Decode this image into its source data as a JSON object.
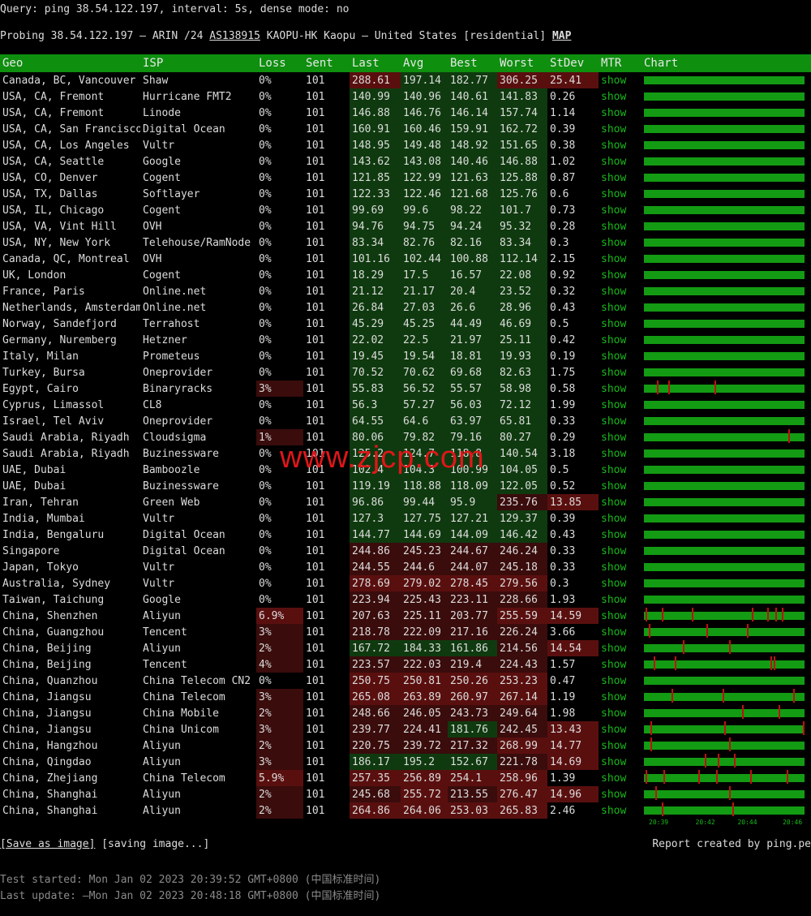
{
  "query": "Query: ping 38.54.122.197, interval: 5s, dense mode: no",
  "probe": {
    "prefix": "Probing 38.54.122.197 – ARIN /24 ",
    "as_link": "AS138915",
    "middle": " KAOPU-HK Kaopu – United States [residential] ",
    "map_link": "MAP"
  },
  "columns": [
    "Geo",
    "ISP",
    "Loss",
    "Sent",
    "Last",
    "Avg",
    "Best",
    "Worst",
    "StDev",
    "MTR",
    "Chart"
  ],
  "mtr_label": "show",
  "colors": {
    "green": "#0f3a0f",
    "red": "#3a0c0c",
    "redDark": "#5a0f0f",
    "header": "#0e8f0e",
    "bar": "#139b13",
    "spike": "#c01010"
  },
  "rows": [
    {
      "geo": "Canada, BC, Vancouver",
      "isp": "Shaw",
      "loss": "0%",
      "sent": "101",
      "last": "288.61",
      "avg": "197.14",
      "best": "182.77",
      "worst": "306.25",
      "stdev": "25.41",
      "spikes": []
    },
    {
      "geo": "USA, CA, Fremont",
      "isp": "Hurricane FMT2",
      "loss": "0%",
      "sent": "101",
      "last": "140.99",
      "avg": "140.96",
      "best": "140.61",
      "worst": "141.83",
      "stdev": "0.26",
      "spikes": []
    },
    {
      "geo": "USA, CA, Fremont",
      "isp": "Linode",
      "loss": "0%",
      "sent": "101",
      "last": "146.88",
      "avg": "146.76",
      "best": "146.14",
      "worst": "157.74",
      "stdev": "1.14",
      "spikes": []
    },
    {
      "geo": "USA, CA, San Francisco",
      "isp": "Digital Ocean",
      "loss": "0%",
      "sent": "101",
      "last": "160.91",
      "avg": "160.46",
      "best": "159.91",
      "worst": "162.72",
      "stdev": "0.39",
      "spikes": []
    },
    {
      "geo": "USA, CA, Los Angeles",
      "isp": "Vultr",
      "loss": "0%",
      "sent": "101",
      "last": "148.95",
      "avg": "149.48",
      "best": "148.92",
      "worst": "151.65",
      "stdev": "0.38",
      "spikes": []
    },
    {
      "geo": "USA, CA, Seattle",
      "isp": "Google",
      "loss": "0%",
      "sent": "101",
      "last": "143.62",
      "avg": "143.08",
      "best": "140.46",
      "worst": "146.88",
      "stdev": "1.02",
      "spikes": []
    },
    {
      "geo": "USA, CO, Denver",
      "isp": "Cogent",
      "loss": "0%",
      "sent": "101",
      "last": "121.85",
      "avg": "122.99",
      "best": "121.63",
      "worst": "125.88",
      "stdev": "0.87",
      "spikes": []
    },
    {
      "geo": "USA, TX, Dallas",
      "isp": "Softlayer",
      "loss": "0%",
      "sent": "101",
      "last": "122.33",
      "avg": "122.46",
      "best": "121.68",
      "worst": "125.76",
      "stdev": "0.6",
      "spikes": []
    },
    {
      "geo": "USA, IL, Chicago",
      "isp": "Cogent",
      "loss": "0%",
      "sent": "101",
      "last": "99.69",
      "avg": "99.6",
      "best": "98.22",
      "worst": "101.7",
      "stdev": "0.73",
      "spikes": []
    },
    {
      "geo": "USA, VA, Vint Hill",
      "isp": "OVH",
      "loss": "0%",
      "sent": "101",
      "last": "94.76",
      "avg": "94.75",
      "best": "94.24",
      "worst": "95.32",
      "stdev": "0.28",
      "spikes": []
    },
    {
      "geo": "USA, NY, New York",
      "isp": "Teleho​use/RamNode",
      "loss": "0%",
      "sent": "101",
      "last": "83.34",
      "avg": "82.76",
      "best": "82.16",
      "worst": "83.34",
      "stdev": "0.3",
      "spikes": []
    },
    {
      "geo": "Canada, QC, Montreal",
      "isp": "OVH",
      "loss": "0%",
      "sent": "101",
      "last": "101.16",
      "avg": "102.44",
      "best": "100.88",
      "worst": "112.14",
      "stdev": "2.15",
      "spikes": []
    },
    {
      "geo": "UK, London",
      "isp": "Cogent",
      "loss": "0%",
      "sent": "101",
      "last": "18.29",
      "avg": "17.5",
      "best": "16.57",
      "worst": "22.08",
      "stdev": "0.92",
      "spikes": []
    },
    {
      "geo": "France, Paris",
      "isp": "Online.net",
      "loss": "0%",
      "sent": "101",
      "last": "21.12",
      "avg": "21.17",
      "best": "20.4",
      "worst": "23.52",
      "stdev": "0.32",
      "spikes": []
    },
    {
      "geo": "Netherlands, Amsterdam",
      "isp": "Online.net",
      "loss": "0%",
      "sent": "101",
      "last": "26.84",
      "avg": "27.03",
      "best": "26.6",
      "worst": "28.96",
      "stdev": "0.43",
      "spikes": []
    },
    {
      "geo": "Norway, Sandefjord",
      "isp": "Terrahost",
      "loss": "0%",
      "sent": "101",
      "last": "45.29",
      "avg": "45.25",
      "best": "44.49",
      "worst": "46.69",
      "stdev": "0.5",
      "spikes": []
    },
    {
      "geo": "Germany, Nuremberg",
      "isp": "Hetzner",
      "loss": "0%",
      "sent": "101",
      "last": "22.02",
      "avg": "22.5",
      "best": "21.97",
      "worst": "25.11",
      "stdev": "0.42",
      "spikes": []
    },
    {
      "geo": "Italy, Milan",
      "isp": "Prometeus",
      "loss": "0%",
      "sent": "101",
      "last": "19.45",
      "avg": "19.54",
      "best": "18.81",
      "worst": "19.93",
      "stdev": "0.19",
      "spikes": []
    },
    {
      "geo": "Turkey, Bursa",
      "isp": "Oneprovider",
      "loss": "0%",
      "sent": "101",
      "last": "70.52",
      "avg": "70.62",
      "best": "69.68",
      "worst": "82.63",
      "stdev": "1.75",
      "spikes": []
    },
    {
      "geo": "Egypt, Cairo",
      "isp": "Binaryracks",
      "loss": "3%",
      "sent": "101",
      "last": "55.83",
      "avg": "56.52",
      "best": "55.57",
      "worst": "58.98",
      "stdev": "0.58",
      "spikes": [
        0.08,
        0.15,
        0.44
      ]
    },
    {
      "geo": "Cyprus, Limassol",
      "isp": "CL8",
      "loss": "0%",
      "sent": "101",
      "last": "56.3",
      "avg": "57.27",
      "best": "56.03",
      "worst": "72.12",
      "stdev": "1.99",
      "spikes": []
    },
    {
      "geo": "Israel, Tel Aviv",
      "isp": "Oneprovider",
      "loss": "0%",
      "sent": "101",
      "last": "64.55",
      "avg": "64.6",
      "best": "63.97",
      "worst": "65.81",
      "stdev": "0.33",
      "spikes": []
    },
    {
      "geo": "Saudi Arabia, Riyadh",
      "isp": "Cloudsigma",
      "loss": "1%",
      "sent": "101",
      "last": "80.06",
      "avg": "79.82",
      "best": "79.16",
      "worst": "80.27",
      "stdev": "0.29",
      "spikes": [
        0.9
      ]
    },
    {
      "geo": "Saudi Arabia, Riyadh",
      "isp": "Buzinessware",
      "loss": "0%",
      "sent": "101",
      "last": "125.2",
      "avg": "124.7",
      "best": "118.8",
      "worst": "140.54",
      "stdev": "3.18",
      "spikes": []
    },
    {
      "geo": "UAE, Dubai",
      "isp": "Bamboozle",
      "loss": "0%",
      "sent": "101",
      "last": "102.4",
      "avg": "104.3",
      "best": "100.99",
      "worst": "104.05",
      "stdev": "0.5",
      "spikes": []
    },
    {
      "geo": "UAE, Dubai",
      "isp": "Buzinessware",
      "loss": "0%",
      "sent": "101",
      "last": "119.19",
      "avg": "118.88",
      "best": "118.09",
      "worst": "122.05",
      "stdev": "0.52",
      "spikes": []
    },
    {
      "geo": "Iran, Tehran",
      "isp": "Green Web",
      "loss": "0%",
      "sent": "101",
      "last": "96.86",
      "avg": "99.44",
      "best": "95.9",
      "worst": "235.76",
      "stdev": "13.85",
      "spikes": []
    },
    {
      "geo": "India, Mumbai",
      "isp": "Vultr",
      "loss": "0%",
      "sent": "101",
      "last": "127.3",
      "avg": "127.75",
      "best": "127.21",
      "worst": "129.37",
      "stdev": "0.39",
      "spikes": []
    },
    {
      "geo": "India, Bengaluru",
      "isp": "Digital Ocean",
      "loss": "0%",
      "sent": "101",
      "last": "144.77",
      "avg": "144.69",
      "best": "144.09",
      "worst": "146.42",
      "stdev": "0.43",
      "spikes": []
    },
    {
      "geo": "Singapore",
      "isp": "Digital Ocean",
      "loss": "0%",
      "sent": "101",
      "last": "244.86",
      "avg": "245.23",
      "best": "244.67",
      "worst": "246.24",
      "stdev": "0.33",
      "spikes": []
    },
    {
      "geo": "Japan, Tokyo",
      "isp": "Vultr",
      "loss": "0%",
      "sent": "101",
      "last": "244.55",
      "avg": "244.6",
      "best": "244.07",
      "worst": "245.18",
      "stdev": "0.33",
      "spikes": []
    },
    {
      "geo": "Australia, Sydney",
      "isp": "Vultr",
      "loss": "0%",
      "sent": "101",
      "last": "278.69",
      "avg": "279.02",
      "best": "278.45",
      "worst": "279.56",
      "stdev": "0.3",
      "spikes": []
    },
    {
      "geo": "Taiwan, Taichung",
      "isp": "Google",
      "loss": "0%",
      "sent": "101",
      "last": "223.94",
      "avg": "225.43",
      "best": "223.11",
      "worst": "228.66",
      "stdev": "1.93",
      "spikes": []
    },
    {
      "geo": "China, Shenzhen",
      "isp": "Aliyun",
      "loss": "6.9%",
      "sent": "101",
      "last": "207.63",
      "avg": "225.11",
      "best": "203.77",
      "worst": "255.59",
      "stdev": "14.59",
      "spikes": [
        0.01,
        0.11,
        0.3,
        0.67,
        0.77,
        0.82,
        0.86
      ]
    },
    {
      "geo": "China, Guangzhou",
      "isp": "Tencent",
      "loss": "3%",
      "sent": "101",
      "last": "218.78",
      "avg": "222.09",
      "best": "217.16",
      "worst": "226.24",
      "stdev": "3.66",
      "spikes": [
        0.03,
        0.39,
        0.64
      ]
    },
    {
      "geo": "China, Beijing",
      "isp": "Aliyun",
      "loss": "2%",
      "sent": "101",
      "last": "167.72",
      "avg": "184.33",
      "best": "161.86",
      "worst": "214.56",
      "stdev": "14.54",
      "spikes": [
        0.24,
        0.53
      ]
    },
    {
      "geo": "China, Beijing",
      "isp": "Tencent",
      "loss": "4%",
      "sent": "101",
      "last": "223.57",
      "avg": "222.03",
      "best": "219.4",
      "worst": "224.43",
      "stdev": "1.57",
      "spikes": [
        0.06,
        0.19,
        0.79,
        0.81
      ]
    },
    {
      "geo": "China, Quanzhou",
      "isp": "China Telecom CN2",
      "loss": "0%",
      "sent": "101",
      "last": "250.75",
      "avg": "250.81",
      "best": "250.26",
      "worst": "253.23",
      "stdev": "0.47",
      "spikes": []
    },
    {
      "geo": "China, Jiangsu",
      "isp": "China Telecom",
      "loss": "3%",
      "sent": "101",
      "last": "265.08",
      "avg": "263.89",
      "best": "260.97",
      "worst": "267.14",
      "stdev": "1.19",
      "spikes": [
        0.17,
        0.49,
        0.93
      ]
    },
    {
      "geo": "China, Jiangsu",
      "isp": "China Mobile",
      "loss": "2%",
      "sent": "101",
      "last": "248.66",
      "avg": "246.05",
      "best": "243.73",
      "worst": "249.64",
      "stdev": "1.98",
      "spikes": [
        0.61,
        0.84
      ]
    },
    {
      "geo": "China, Jiangsu",
      "isp": "China Unicom",
      "loss": "3%",
      "sent": "101",
      "last": "239.77",
      "avg": "224.41",
      "best": "181.76",
      "worst": "242.45",
      "stdev": "13.43",
      "spikes": [
        0.04,
        0.5,
        0.99
      ]
    },
    {
      "geo": "China, Hangzhou",
      "isp": "Aliyun",
      "loss": "2%",
      "sent": "101",
      "last": "220.75",
      "avg": "239.72",
      "best": "217.32",
      "worst": "268.99",
      "stdev": "14.77",
      "spikes": [
        0.04,
        0.53
      ]
    },
    {
      "geo": "China, Qingdao",
      "isp": "Aliyun",
      "loss": "3%",
      "sent": "101",
      "last": "186.17",
      "avg": "195.2",
      "best": "152.67",
      "worst": "221.78",
      "stdev": "14.69",
      "spikes": [
        0.38,
        0.46,
        0.56
      ]
    },
    {
      "geo": "China, Zhejiang",
      "isp": "China Telecom",
      "loss": "5.9%",
      "sent": "101",
      "last": "257.35",
      "avg": "256.89",
      "best": "254.1",
      "worst": "258.96",
      "stdev": "1.39",
      "spikes": [
        0.01,
        0.12,
        0.34,
        0.45,
        0.66,
        0.89
      ]
    },
    {
      "geo": "China, Shanghai",
      "isp": "Aliyun",
      "loss": "2%",
      "sent": "101",
      "last": "245.68",
      "avg": "255.72",
      "best": "213.55",
      "worst": "276.47",
      "stdev": "14.96",
      "spikes": [
        0.07,
        0.53
      ]
    },
    {
      "geo": "China, Shanghai",
      "isp": "Aliyun",
      "loss": "2%",
      "sent": "101",
      "last": "264.86",
      "avg": "264.06",
      "best": "253.03",
      "worst": "265.83",
      "stdev": "2.46",
      "spikes": [
        0.11,
        0.55
      ]
    }
  ],
  "axis_labels": [
    "20:39",
    "20:42",
    "20:44",
    "20:46"
  ],
  "actions": {
    "save": "[Save as image]",
    "saving": " [saving image...]"
  },
  "report": "Report created by ping.pe",
  "test_started": "Test started: Mon Jan 02 2023 20:39:52 GMT+0800 (中国标准时间)",
  "last_update": "Last update: —Mon Jan 02 2023 20:48:18 GMT+0800 (中国标准时间)",
  "watermark": "www.zjcp.com"
}
